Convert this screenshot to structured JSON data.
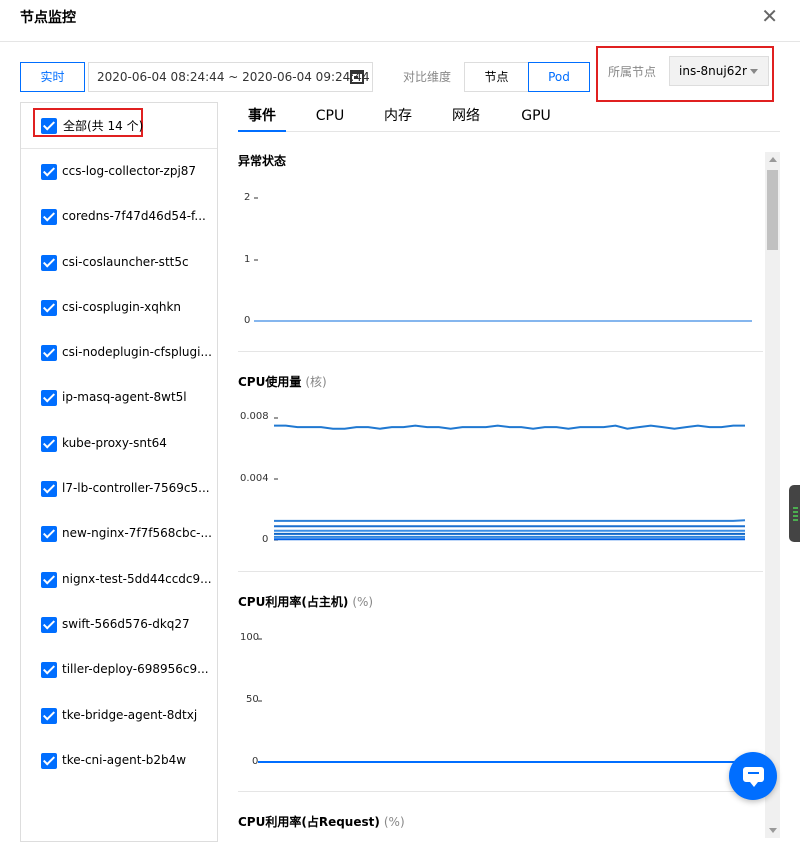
{
  "dialog": {
    "title": "节点监控",
    "close_symbol": "✕"
  },
  "toolbar": {
    "realtime_label": "实时",
    "date_range": "2020-06-04 08:24:44 ~ 2020-06-04 09:24:44",
    "compare_label": "对比维度",
    "dim_options": [
      "节点",
      "Pod"
    ],
    "selected_dim": "Pod",
    "node_label": "所属节点",
    "node_value": "ins-8nuj62r"
  },
  "left_panel": {
    "all_label": "全部(共 14 个)",
    "all_checked": true,
    "pods": [
      {
        "label": "ccs-log-collector-zpj87",
        "checked": true
      },
      {
        "label": "coredns-7f47d46d54-f...",
        "checked": true
      },
      {
        "label": "csi-coslauncher-stt5c",
        "checked": true
      },
      {
        "label": "csi-cosplugin-xqhkn",
        "checked": true
      },
      {
        "label": "csi-nodeplugin-cfsplugi...",
        "checked": true
      },
      {
        "label": "ip-masq-agent-8wt5l",
        "checked": true
      },
      {
        "label": "kube-proxy-snt64",
        "checked": true
      },
      {
        "label": "l7-lb-controller-7569c5...",
        "checked": true
      },
      {
        "label": "new-nginx-7f7f568cbc-...",
        "checked": true
      },
      {
        "label": "nignx-test-5dd44ccdc9...",
        "checked": true
      },
      {
        "label": "swift-566d576-dkq27",
        "checked": true
      },
      {
        "label": "tiller-deploy-698956c9...",
        "checked": true
      },
      {
        "label": "tke-bridge-agent-8dtxj",
        "checked": true
      },
      {
        "label": "tke-cni-agent-b2b4w",
        "checked": true
      }
    ]
  },
  "tabs": [
    "事件",
    "CPU",
    "内存",
    "网络",
    "GPU"
  ],
  "active_tab": "事件",
  "colors": {
    "accent": "#006eff",
    "highlight": "#e02020"
  },
  "charts": [
    {
      "title": "异常状态",
      "unit": "",
      "ticks": [
        "2",
        "1",
        "0"
      ]
    },
    {
      "title": "CPU使用量",
      "unit": "(核)",
      "ticks": [
        "0.008",
        "0.004",
        "0"
      ]
    },
    {
      "title": "CPU利用率(占主机)",
      "unit": "(%)",
      "ticks": [
        "100",
        "50",
        "0"
      ]
    },
    {
      "title": "CPU利用率(占Request)",
      "unit": "(%)",
      "ticks": []
    }
  ],
  "chart_data": [
    {
      "type": "line",
      "title": "异常状态",
      "ylabel": "",
      "ylim": [
        0,
        2
      ],
      "series": [
        {
          "values": [
            0,
            0,
            0,
            0,
            0,
            0,
            0,
            0,
            0,
            0,
            0,
            0,
            0,
            0,
            0,
            0,
            0,
            0,
            0,
            0,
            0,
            0,
            0,
            0,
            0,
            0,
            0,
            0,
            0,
            0,
            0,
            0,
            0,
            0,
            0,
            0,
            0,
            0,
            0,
            0,
            0
          ]
        }
      ]
    },
    {
      "type": "line",
      "title": "CPU使用量",
      "ylabel": "核",
      "ylim": [
        0,
        0.008
      ],
      "series": [
        {
          "values": [
            0.0075,
            0.0075,
            0.0074,
            0.0074,
            0.0074,
            0.0073,
            0.0073,
            0.0074,
            0.0074,
            0.0073,
            0.0074,
            0.0074,
            0.0075,
            0.0074,
            0.0074,
            0.0073,
            0.0074,
            0.0074,
            0.0074,
            0.0075,
            0.0074,
            0.0074,
            0.0073,
            0.0074,
            0.0074,
            0.0073,
            0.0074,
            0.0074,
            0.0074,
            0.0075,
            0.0073,
            0.0074,
            0.0075,
            0.0074,
            0.0073,
            0.0074,
            0.0075,
            0.0074,
            0.0074,
            0.0075,
            0.0075
          ]
        },
        {
          "values": [
            0.00125,
            0.00125,
            0.00125,
            0.00125,
            0.00125,
            0.00125,
            0.00125,
            0.00125,
            0.00125,
            0.00125,
            0.00125,
            0.00125,
            0.00125,
            0.00125,
            0.00125,
            0.00125,
            0.00125,
            0.00125,
            0.00125,
            0.00125,
            0.00125,
            0.00125,
            0.00125,
            0.00125,
            0.00125,
            0.00125,
            0.00125,
            0.00125,
            0.00125,
            0.00125,
            0.00125,
            0.00125,
            0.00125,
            0.00125,
            0.00125,
            0.00125,
            0.00125,
            0.00125,
            0.00125,
            0.00125,
            0.0013
          ]
        },
        {
          "values": [
            0.0009,
            0.0009,
            0.0009,
            0.0009,
            0.0009,
            0.0009,
            0.0009,
            0.0009,
            0.0009,
            0.0009,
            0.0009,
            0.0009,
            0.0009,
            0.0009,
            0.0009,
            0.0009,
            0.0009,
            0.0009,
            0.0009,
            0.0009,
            0.0009,
            0.0009,
            0.0009,
            0.0009,
            0.0009,
            0.0009,
            0.0009,
            0.0009,
            0.0009,
            0.0009,
            0.0009,
            0.0009,
            0.0009,
            0.0009,
            0.0009,
            0.0009,
            0.0009,
            0.0009,
            0.0009,
            0.0009,
            0.0009
          ]
        },
        {
          "values": [
            0.0006,
            0.0006,
            0.0006,
            0.0006,
            0.0006,
            0.0006,
            0.0006,
            0.0006,
            0.0006,
            0.0006,
            0.0006,
            0.0006,
            0.0006,
            0.0006,
            0.0006,
            0.0006,
            0.0006,
            0.0006,
            0.0006,
            0.0006,
            0.0006,
            0.0006,
            0.0006,
            0.0006,
            0.0006,
            0.0006,
            0.0006,
            0.0006,
            0.0006,
            0.0006,
            0.0006,
            0.0006,
            0.0006,
            0.0006,
            0.0006,
            0.0006,
            0.0006,
            0.0006,
            0.0006,
            0.0006,
            0.0006
          ]
        },
        {
          "values": [
            0.0004,
            0.0004,
            0.0004,
            0.0004,
            0.0004,
            0.0004,
            0.0004,
            0.0004,
            0.0004,
            0.0004,
            0.0004,
            0.0004,
            0.0004,
            0.0004,
            0.0004,
            0.0004,
            0.0004,
            0.0004,
            0.0004,
            0.0004,
            0.0004,
            0.0004,
            0.0004,
            0.0004,
            0.0004,
            0.0004,
            0.0004,
            0.0004,
            0.0004,
            0.0004,
            0.0004,
            0.0004,
            0.0004,
            0.0004,
            0.0004,
            0.0004,
            0.0004,
            0.0004,
            0.0004,
            0.0004,
            0.0004
          ]
        },
        {
          "values": [
            0.0002,
            0.0002,
            0.0002,
            0.0002,
            0.0002,
            0.0002,
            0.0002,
            0.0002,
            0.0002,
            0.0002,
            0.0002,
            0.0002,
            0.0002,
            0.0002,
            0.0002,
            0.0002,
            0.0002,
            0.0002,
            0.0002,
            0.0002,
            0.0002,
            0.0002,
            0.0002,
            0.0002,
            0.0002,
            0.0002,
            0.0002,
            0.0002,
            0.0002,
            0.0002,
            0.0002,
            0.0002,
            0.0002,
            0.0002,
            0.0002,
            0.0002,
            0.0002,
            0.0002,
            0.0002,
            0.0002,
            0.0002
          ]
        },
        {
          "values": [
            5e-05,
            5e-05,
            5e-05,
            5e-05,
            5e-05,
            5e-05,
            5e-05,
            5e-05,
            5e-05,
            5e-05,
            5e-05,
            5e-05,
            5e-05,
            5e-05,
            5e-05,
            5e-05,
            5e-05,
            5e-05,
            5e-05,
            5e-05,
            5e-05,
            5e-05,
            5e-05,
            5e-05,
            5e-05,
            5e-05,
            5e-05,
            5e-05,
            5e-05,
            5e-05,
            5e-05,
            5e-05,
            5e-05,
            5e-05,
            5e-05,
            5e-05,
            5e-05,
            5e-05,
            5e-05,
            5e-05,
            5e-05
          ]
        }
      ]
    },
    {
      "type": "line",
      "title": "CPU利用率(占主机)",
      "ylabel": "%",
      "ylim": [
        0,
        100
      ],
      "series": [
        {
          "values": [
            0,
            0,
            0,
            0,
            0,
            0,
            0,
            0,
            0,
            0,
            0,
            0,
            0,
            0,
            0,
            0,
            0,
            0,
            0,
            0,
            0,
            0,
            0,
            0,
            0,
            0,
            0,
            0,
            0,
            0,
            0,
            0,
            0,
            0,
            0,
            0,
            0,
            0,
            0,
            0,
            0
          ]
        }
      ]
    }
  ]
}
